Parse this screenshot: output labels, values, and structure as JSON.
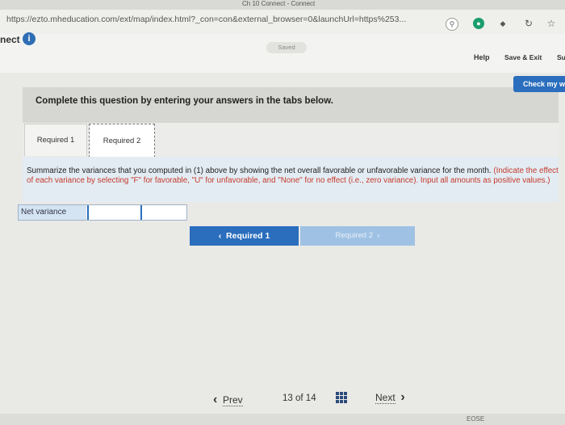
{
  "browser": {
    "tab_title": "Ch 10 Connect - Connect",
    "url": "https://ezto.mheducation.com/ext/map/index.html?_con=con&external_browser=0&launchUrl=https%253..."
  },
  "header": {
    "connect_label": "nect",
    "info_icon": "i",
    "saved_label": "Saved",
    "help_label": "Help",
    "save_exit_label": "Save & Exit",
    "submit_label_fragment": "Su",
    "check_label": "Check my w"
  },
  "question": {
    "instruction": "Complete this question by entering your answers in the tabs below.",
    "tabs": [
      {
        "label": "Required 1"
      },
      {
        "label": "Required 2"
      }
    ],
    "body_text": "Summarize the variances that you computed in (1) above by showing the net overall favorable or unfavorable variance for the month.",
    "body_red": "(Indicate the effect of each variance by selecting \"F\" for favorable, \"U\" for unfavorable, and \"None\" for no effect (i.e., zero variance). Input all amounts as positive values.)",
    "row_label": "Net variance",
    "btn_prev_label": "Required 1",
    "btn_next_label": "Required 2"
  },
  "footer": {
    "prev_label": "Prev",
    "page_current": "13",
    "page_of": "of",
    "page_total": "14",
    "next_label": "Next",
    "taskbar_fragment": "EOSE"
  },
  "colors": {
    "accent": "#2a6ebd",
    "instruction_red": "#c53a2c"
  }
}
